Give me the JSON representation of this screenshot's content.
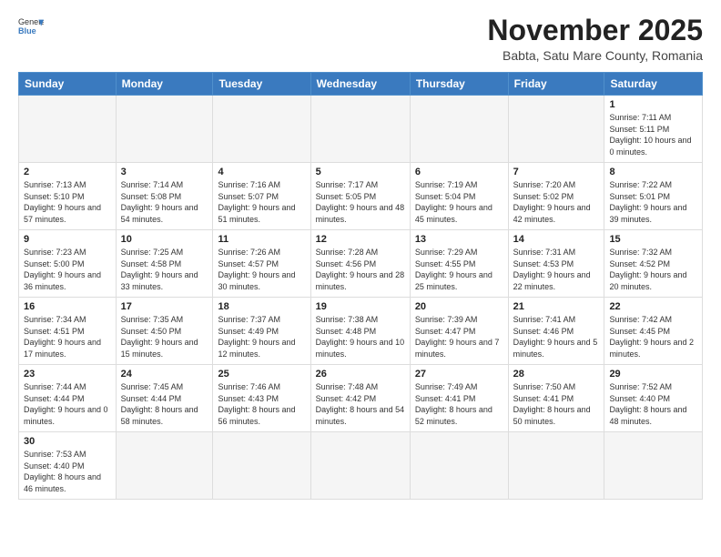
{
  "header": {
    "logo_general": "General",
    "logo_blue": "Blue",
    "month_title": "November 2025",
    "subtitle": "Babta, Satu Mare County, Romania"
  },
  "weekdays": [
    "Sunday",
    "Monday",
    "Tuesday",
    "Wednesday",
    "Thursday",
    "Friday",
    "Saturday"
  ],
  "weeks": [
    [
      {
        "day": "",
        "info": ""
      },
      {
        "day": "",
        "info": ""
      },
      {
        "day": "",
        "info": ""
      },
      {
        "day": "",
        "info": ""
      },
      {
        "day": "",
        "info": ""
      },
      {
        "day": "",
        "info": ""
      },
      {
        "day": "1",
        "info": "Sunrise: 7:11 AM\nSunset: 5:11 PM\nDaylight: 10 hours\nand 0 minutes."
      }
    ],
    [
      {
        "day": "2",
        "info": "Sunrise: 7:13 AM\nSunset: 5:10 PM\nDaylight: 9 hours\nand 57 minutes."
      },
      {
        "day": "3",
        "info": "Sunrise: 7:14 AM\nSunset: 5:08 PM\nDaylight: 9 hours\nand 54 minutes."
      },
      {
        "day": "4",
        "info": "Sunrise: 7:16 AM\nSunset: 5:07 PM\nDaylight: 9 hours\nand 51 minutes."
      },
      {
        "day": "5",
        "info": "Sunrise: 7:17 AM\nSunset: 5:05 PM\nDaylight: 9 hours\nand 48 minutes."
      },
      {
        "day": "6",
        "info": "Sunrise: 7:19 AM\nSunset: 5:04 PM\nDaylight: 9 hours\nand 45 minutes."
      },
      {
        "day": "7",
        "info": "Sunrise: 7:20 AM\nSunset: 5:02 PM\nDaylight: 9 hours\nand 42 minutes."
      },
      {
        "day": "8",
        "info": "Sunrise: 7:22 AM\nSunset: 5:01 PM\nDaylight: 9 hours\nand 39 minutes."
      }
    ],
    [
      {
        "day": "9",
        "info": "Sunrise: 7:23 AM\nSunset: 5:00 PM\nDaylight: 9 hours\nand 36 minutes."
      },
      {
        "day": "10",
        "info": "Sunrise: 7:25 AM\nSunset: 4:58 PM\nDaylight: 9 hours\nand 33 minutes."
      },
      {
        "day": "11",
        "info": "Sunrise: 7:26 AM\nSunset: 4:57 PM\nDaylight: 9 hours\nand 30 minutes."
      },
      {
        "day": "12",
        "info": "Sunrise: 7:28 AM\nSunset: 4:56 PM\nDaylight: 9 hours\nand 28 minutes."
      },
      {
        "day": "13",
        "info": "Sunrise: 7:29 AM\nSunset: 4:55 PM\nDaylight: 9 hours\nand 25 minutes."
      },
      {
        "day": "14",
        "info": "Sunrise: 7:31 AM\nSunset: 4:53 PM\nDaylight: 9 hours\nand 22 minutes."
      },
      {
        "day": "15",
        "info": "Sunrise: 7:32 AM\nSunset: 4:52 PM\nDaylight: 9 hours\nand 20 minutes."
      }
    ],
    [
      {
        "day": "16",
        "info": "Sunrise: 7:34 AM\nSunset: 4:51 PM\nDaylight: 9 hours\nand 17 minutes."
      },
      {
        "day": "17",
        "info": "Sunrise: 7:35 AM\nSunset: 4:50 PM\nDaylight: 9 hours\nand 15 minutes."
      },
      {
        "day": "18",
        "info": "Sunrise: 7:37 AM\nSunset: 4:49 PM\nDaylight: 9 hours\nand 12 minutes."
      },
      {
        "day": "19",
        "info": "Sunrise: 7:38 AM\nSunset: 4:48 PM\nDaylight: 9 hours\nand 10 minutes."
      },
      {
        "day": "20",
        "info": "Sunrise: 7:39 AM\nSunset: 4:47 PM\nDaylight: 9 hours\nand 7 minutes."
      },
      {
        "day": "21",
        "info": "Sunrise: 7:41 AM\nSunset: 4:46 PM\nDaylight: 9 hours\nand 5 minutes."
      },
      {
        "day": "22",
        "info": "Sunrise: 7:42 AM\nSunset: 4:45 PM\nDaylight: 9 hours\nand 2 minutes."
      }
    ],
    [
      {
        "day": "23",
        "info": "Sunrise: 7:44 AM\nSunset: 4:44 PM\nDaylight: 9 hours\nand 0 minutes."
      },
      {
        "day": "24",
        "info": "Sunrise: 7:45 AM\nSunset: 4:44 PM\nDaylight: 8 hours\nand 58 minutes."
      },
      {
        "day": "25",
        "info": "Sunrise: 7:46 AM\nSunset: 4:43 PM\nDaylight: 8 hours\nand 56 minutes."
      },
      {
        "day": "26",
        "info": "Sunrise: 7:48 AM\nSunset: 4:42 PM\nDaylight: 8 hours\nand 54 minutes."
      },
      {
        "day": "27",
        "info": "Sunrise: 7:49 AM\nSunset: 4:41 PM\nDaylight: 8 hours\nand 52 minutes."
      },
      {
        "day": "28",
        "info": "Sunrise: 7:50 AM\nSunset: 4:41 PM\nDaylight: 8 hours\nand 50 minutes."
      },
      {
        "day": "29",
        "info": "Sunrise: 7:52 AM\nSunset: 4:40 PM\nDaylight: 8 hours\nand 48 minutes."
      }
    ],
    [
      {
        "day": "30",
        "info": "Sunrise: 7:53 AM\nSunset: 4:40 PM\nDaylight: 8 hours\nand 46 minutes."
      },
      {
        "day": "",
        "info": ""
      },
      {
        "day": "",
        "info": ""
      },
      {
        "day": "",
        "info": ""
      },
      {
        "day": "",
        "info": ""
      },
      {
        "day": "",
        "info": ""
      },
      {
        "day": "",
        "info": ""
      }
    ]
  ]
}
